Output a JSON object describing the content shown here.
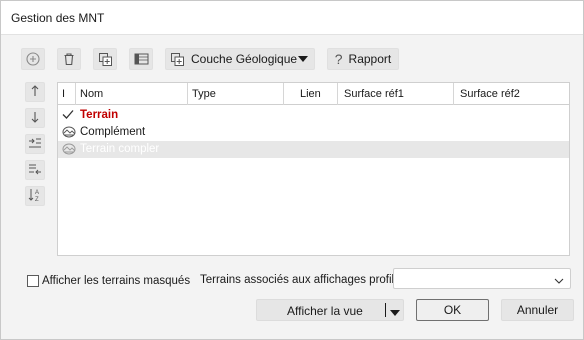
{
  "window": {
    "title": "Gestion des MNT"
  },
  "toolbar": {
    "add_icon": "plus-circle-icon",
    "delete_icon": "trash-icon",
    "dropdown_label": "Couche Géologique",
    "report_label": "Rapport",
    "report_icon": "question-mark-icon"
  },
  "side_tools": [
    "arrow-up-icon",
    "arrow-down-icon",
    "indent-icon",
    "outdent-icon",
    "sort-az-icon"
  ],
  "grid": {
    "columns": [
      "I",
      "Nom",
      "Type",
      "Lien",
      "Surface réf1",
      "Surface réf2"
    ],
    "rows": [
      {
        "name": "Terrain",
        "icon": "checkmark-icon",
        "style": "active",
        "color": "#c00000"
      },
      {
        "name": "Complément",
        "icon": "terrain-icon",
        "style": "normal"
      },
      {
        "name": "Terrain compler",
        "icon": "terrain-icon",
        "style": "selected"
      }
    ]
  },
  "footer": {
    "show_hidden_label": "Afficher les terrains masqués",
    "assoc_label": "Terrains associés aux affichages profils :",
    "assoc_value": "",
    "view_button": "Afficher la vue",
    "ok_button": "OK",
    "cancel_button": "Annuler"
  }
}
